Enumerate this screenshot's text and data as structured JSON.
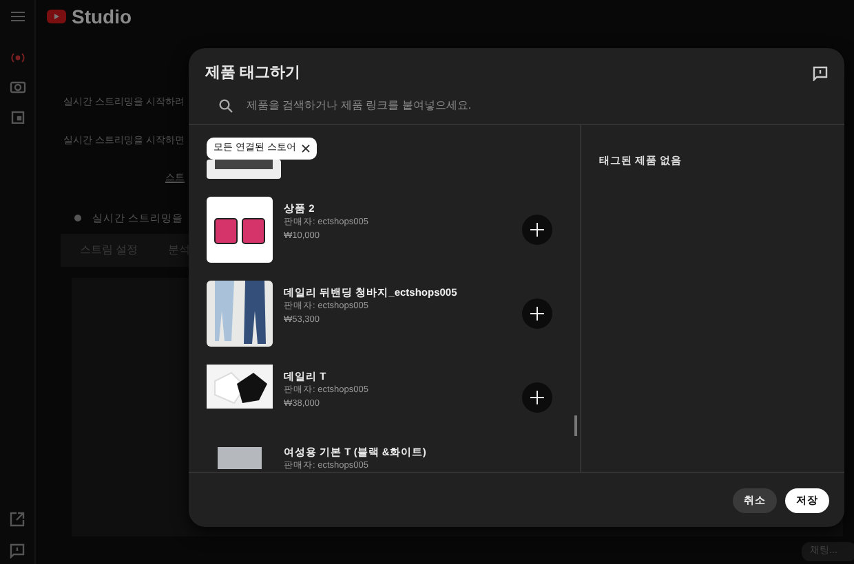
{
  "app": {
    "title": "Studio"
  },
  "background": {
    "texts": [
      "실시간 스트리밍을 시작하려",
      "실시간 스트리밍을 시작하면",
      "스트"
    ],
    "status_line": "실시간 스트리밍을",
    "tabs": [
      "스트림 설정",
      "분석"
    ],
    "chat_placeholder": "채팅..."
  },
  "dialog": {
    "title": "제품 태그하기",
    "search": {
      "placeholder": "제품을 검색하거나 제품 링크를 붙여넣으세요."
    },
    "filter_chip": {
      "label": "모든 연결된 스토어"
    },
    "products": [
      {
        "kind": "partial"
      },
      {
        "kind": "full",
        "name": "상품 2",
        "seller": "판매자: ectshops005",
        "price": "₩10,000"
      },
      {
        "kind": "full",
        "name": "데일리 뒤밴딩 청바지_ectshops005",
        "seller": "판매자: ectshops005",
        "price": "₩53,300"
      },
      {
        "kind": "full",
        "name": "데일리 T",
        "seller": "판매자: ectshops005",
        "price": "₩38,000"
      },
      {
        "kind": "cut",
        "name": "여성용 기본 T (블랙 &화이트)",
        "seller": "판매자: ectshops005"
      }
    ],
    "tagged_heading": "태그된 제품 없음",
    "buttons": [
      {
        "label": "취소",
        "kind": "secondary"
      },
      {
        "label": "저장",
        "kind": "primary"
      }
    ]
  }
}
